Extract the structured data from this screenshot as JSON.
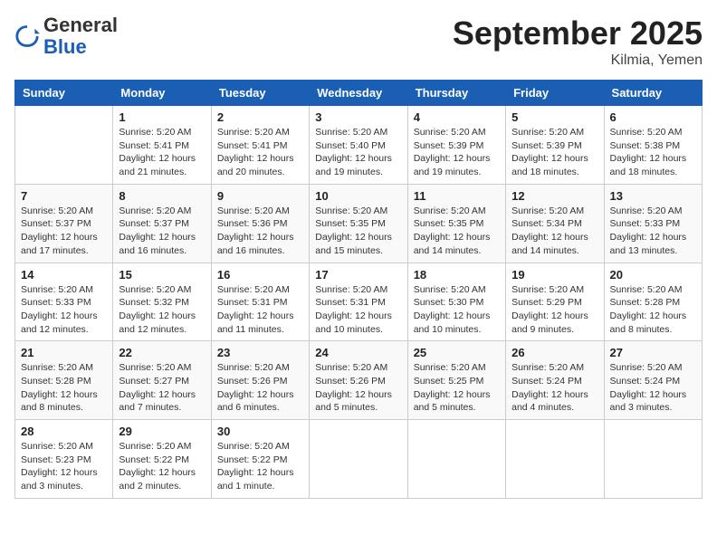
{
  "header": {
    "logo_general": "General",
    "logo_blue": "Blue",
    "month_title": "September 2025",
    "location": "Kilmia, Yemen"
  },
  "days_of_week": [
    "Sunday",
    "Monday",
    "Tuesday",
    "Wednesday",
    "Thursday",
    "Friday",
    "Saturday"
  ],
  "weeks": [
    [
      {
        "day": "",
        "info": ""
      },
      {
        "day": "1",
        "info": "Sunrise: 5:20 AM\nSunset: 5:41 PM\nDaylight: 12 hours\nand 21 minutes."
      },
      {
        "day": "2",
        "info": "Sunrise: 5:20 AM\nSunset: 5:41 PM\nDaylight: 12 hours\nand 20 minutes."
      },
      {
        "day": "3",
        "info": "Sunrise: 5:20 AM\nSunset: 5:40 PM\nDaylight: 12 hours\nand 19 minutes."
      },
      {
        "day": "4",
        "info": "Sunrise: 5:20 AM\nSunset: 5:39 PM\nDaylight: 12 hours\nand 19 minutes."
      },
      {
        "day": "5",
        "info": "Sunrise: 5:20 AM\nSunset: 5:39 PM\nDaylight: 12 hours\nand 18 minutes."
      },
      {
        "day": "6",
        "info": "Sunrise: 5:20 AM\nSunset: 5:38 PM\nDaylight: 12 hours\nand 18 minutes."
      }
    ],
    [
      {
        "day": "7",
        "info": "Sunrise: 5:20 AM\nSunset: 5:37 PM\nDaylight: 12 hours\nand 17 minutes."
      },
      {
        "day": "8",
        "info": "Sunrise: 5:20 AM\nSunset: 5:37 PM\nDaylight: 12 hours\nand 16 minutes."
      },
      {
        "day": "9",
        "info": "Sunrise: 5:20 AM\nSunset: 5:36 PM\nDaylight: 12 hours\nand 16 minutes."
      },
      {
        "day": "10",
        "info": "Sunrise: 5:20 AM\nSunset: 5:35 PM\nDaylight: 12 hours\nand 15 minutes."
      },
      {
        "day": "11",
        "info": "Sunrise: 5:20 AM\nSunset: 5:35 PM\nDaylight: 12 hours\nand 14 minutes."
      },
      {
        "day": "12",
        "info": "Sunrise: 5:20 AM\nSunset: 5:34 PM\nDaylight: 12 hours\nand 14 minutes."
      },
      {
        "day": "13",
        "info": "Sunrise: 5:20 AM\nSunset: 5:33 PM\nDaylight: 12 hours\nand 13 minutes."
      }
    ],
    [
      {
        "day": "14",
        "info": "Sunrise: 5:20 AM\nSunset: 5:33 PM\nDaylight: 12 hours\nand 12 minutes."
      },
      {
        "day": "15",
        "info": "Sunrise: 5:20 AM\nSunset: 5:32 PM\nDaylight: 12 hours\nand 12 minutes."
      },
      {
        "day": "16",
        "info": "Sunrise: 5:20 AM\nSunset: 5:31 PM\nDaylight: 12 hours\nand 11 minutes."
      },
      {
        "day": "17",
        "info": "Sunrise: 5:20 AM\nSunset: 5:31 PM\nDaylight: 12 hours\nand 10 minutes."
      },
      {
        "day": "18",
        "info": "Sunrise: 5:20 AM\nSunset: 5:30 PM\nDaylight: 12 hours\nand 10 minutes."
      },
      {
        "day": "19",
        "info": "Sunrise: 5:20 AM\nSunset: 5:29 PM\nDaylight: 12 hours\nand 9 minutes."
      },
      {
        "day": "20",
        "info": "Sunrise: 5:20 AM\nSunset: 5:28 PM\nDaylight: 12 hours\nand 8 minutes."
      }
    ],
    [
      {
        "day": "21",
        "info": "Sunrise: 5:20 AM\nSunset: 5:28 PM\nDaylight: 12 hours\nand 8 minutes."
      },
      {
        "day": "22",
        "info": "Sunrise: 5:20 AM\nSunset: 5:27 PM\nDaylight: 12 hours\nand 7 minutes."
      },
      {
        "day": "23",
        "info": "Sunrise: 5:20 AM\nSunset: 5:26 PM\nDaylight: 12 hours\nand 6 minutes."
      },
      {
        "day": "24",
        "info": "Sunrise: 5:20 AM\nSunset: 5:26 PM\nDaylight: 12 hours\nand 5 minutes."
      },
      {
        "day": "25",
        "info": "Sunrise: 5:20 AM\nSunset: 5:25 PM\nDaylight: 12 hours\nand 5 minutes."
      },
      {
        "day": "26",
        "info": "Sunrise: 5:20 AM\nSunset: 5:24 PM\nDaylight: 12 hours\nand 4 minutes."
      },
      {
        "day": "27",
        "info": "Sunrise: 5:20 AM\nSunset: 5:24 PM\nDaylight: 12 hours\nand 3 minutes."
      }
    ],
    [
      {
        "day": "28",
        "info": "Sunrise: 5:20 AM\nSunset: 5:23 PM\nDaylight: 12 hours\nand 3 minutes."
      },
      {
        "day": "29",
        "info": "Sunrise: 5:20 AM\nSunset: 5:22 PM\nDaylight: 12 hours\nand 2 minutes."
      },
      {
        "day": "30",
        "info": "Sunrise: 5:20 AM\nSunset: 5:22 PM\nDaylight: 12 hours\nand 1 minute."
      },
      {
        "day": "",
        "info": ""
      },
      {
        "day": "",
        "info": ""
      },
      {
        "day": "",
        "info": ""
      },
      {
        "day": "",
        "info": ""
      }
    ]
  ]
}
